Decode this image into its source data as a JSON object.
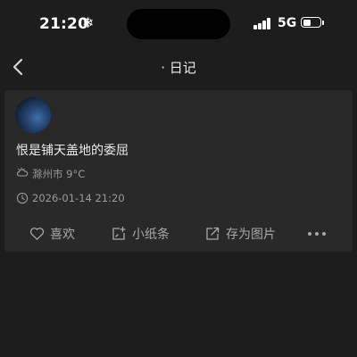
{
  "status_bar": {
    "time": "21:20",
    "weather_symbol": "❄",
    "network": "5G",
    "battery_level": 0.5
  },
  "nav": {
    "title": "· 日记",
    "back_icon": "chevron-left-icon"
  },
  "post": {
    "content": "恨是铺天盖地的委屈",
    "weather": "滁州市 9°C",
    "weather_icon": "partly-cloudy-icon",
    "datetime": "2026-01-14 21:20",
    "datetime_icon": "clock-icon"
  },
  "actions": {
    "like_label": "喜欢",
    "note_label": "小纸条",
    "save_image_label": "存为图片",
    "more_icon": "more-horizontal-icon"
  },
  "colors": {
    "background": "#1c1d1c",
    "card": "#292929",
    "text_primary": "#ececec",
    "text_secondary": "#9a9a9a"
  }
}
